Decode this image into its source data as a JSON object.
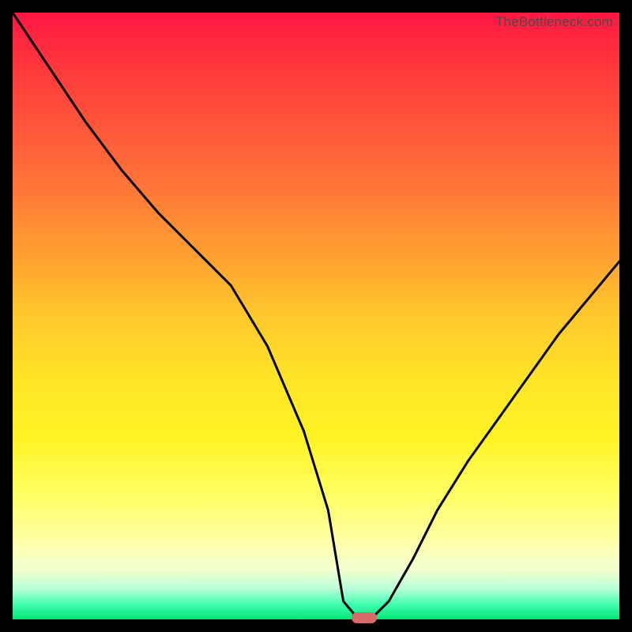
{
  "watermark": "TheBottleneck.com",
  "chart_data": {
    "type": "line",
    "title": "",
    "xlabel": "",
    "ylabel": "",
    "xlim": [
      0,
      100
    ],
    "ylim": [
      0,
      100
    ],
    "x": [
      0,
      6,
      12,
      18,
      24,
      30,
      36,
      42,
      48,
      52,
      54.5,
      57,
      59,
      62,
      66,
      70,
      75,
      80,
      85,
      90,
      95,
      100
    ],
    "values": [
      100,
      91,
      82,
      74,
      67,
      61,
      55,
      45,
      31,
      18,
      3,
      0,
      0,
      3,
      10,
      18,
      26,
      33,
      40,
      47,
      53,
      59
    ],
    "marker": {
      "x": 58,
      "y": 0,
      "color": "#d96a6a"
    }
  }
}
